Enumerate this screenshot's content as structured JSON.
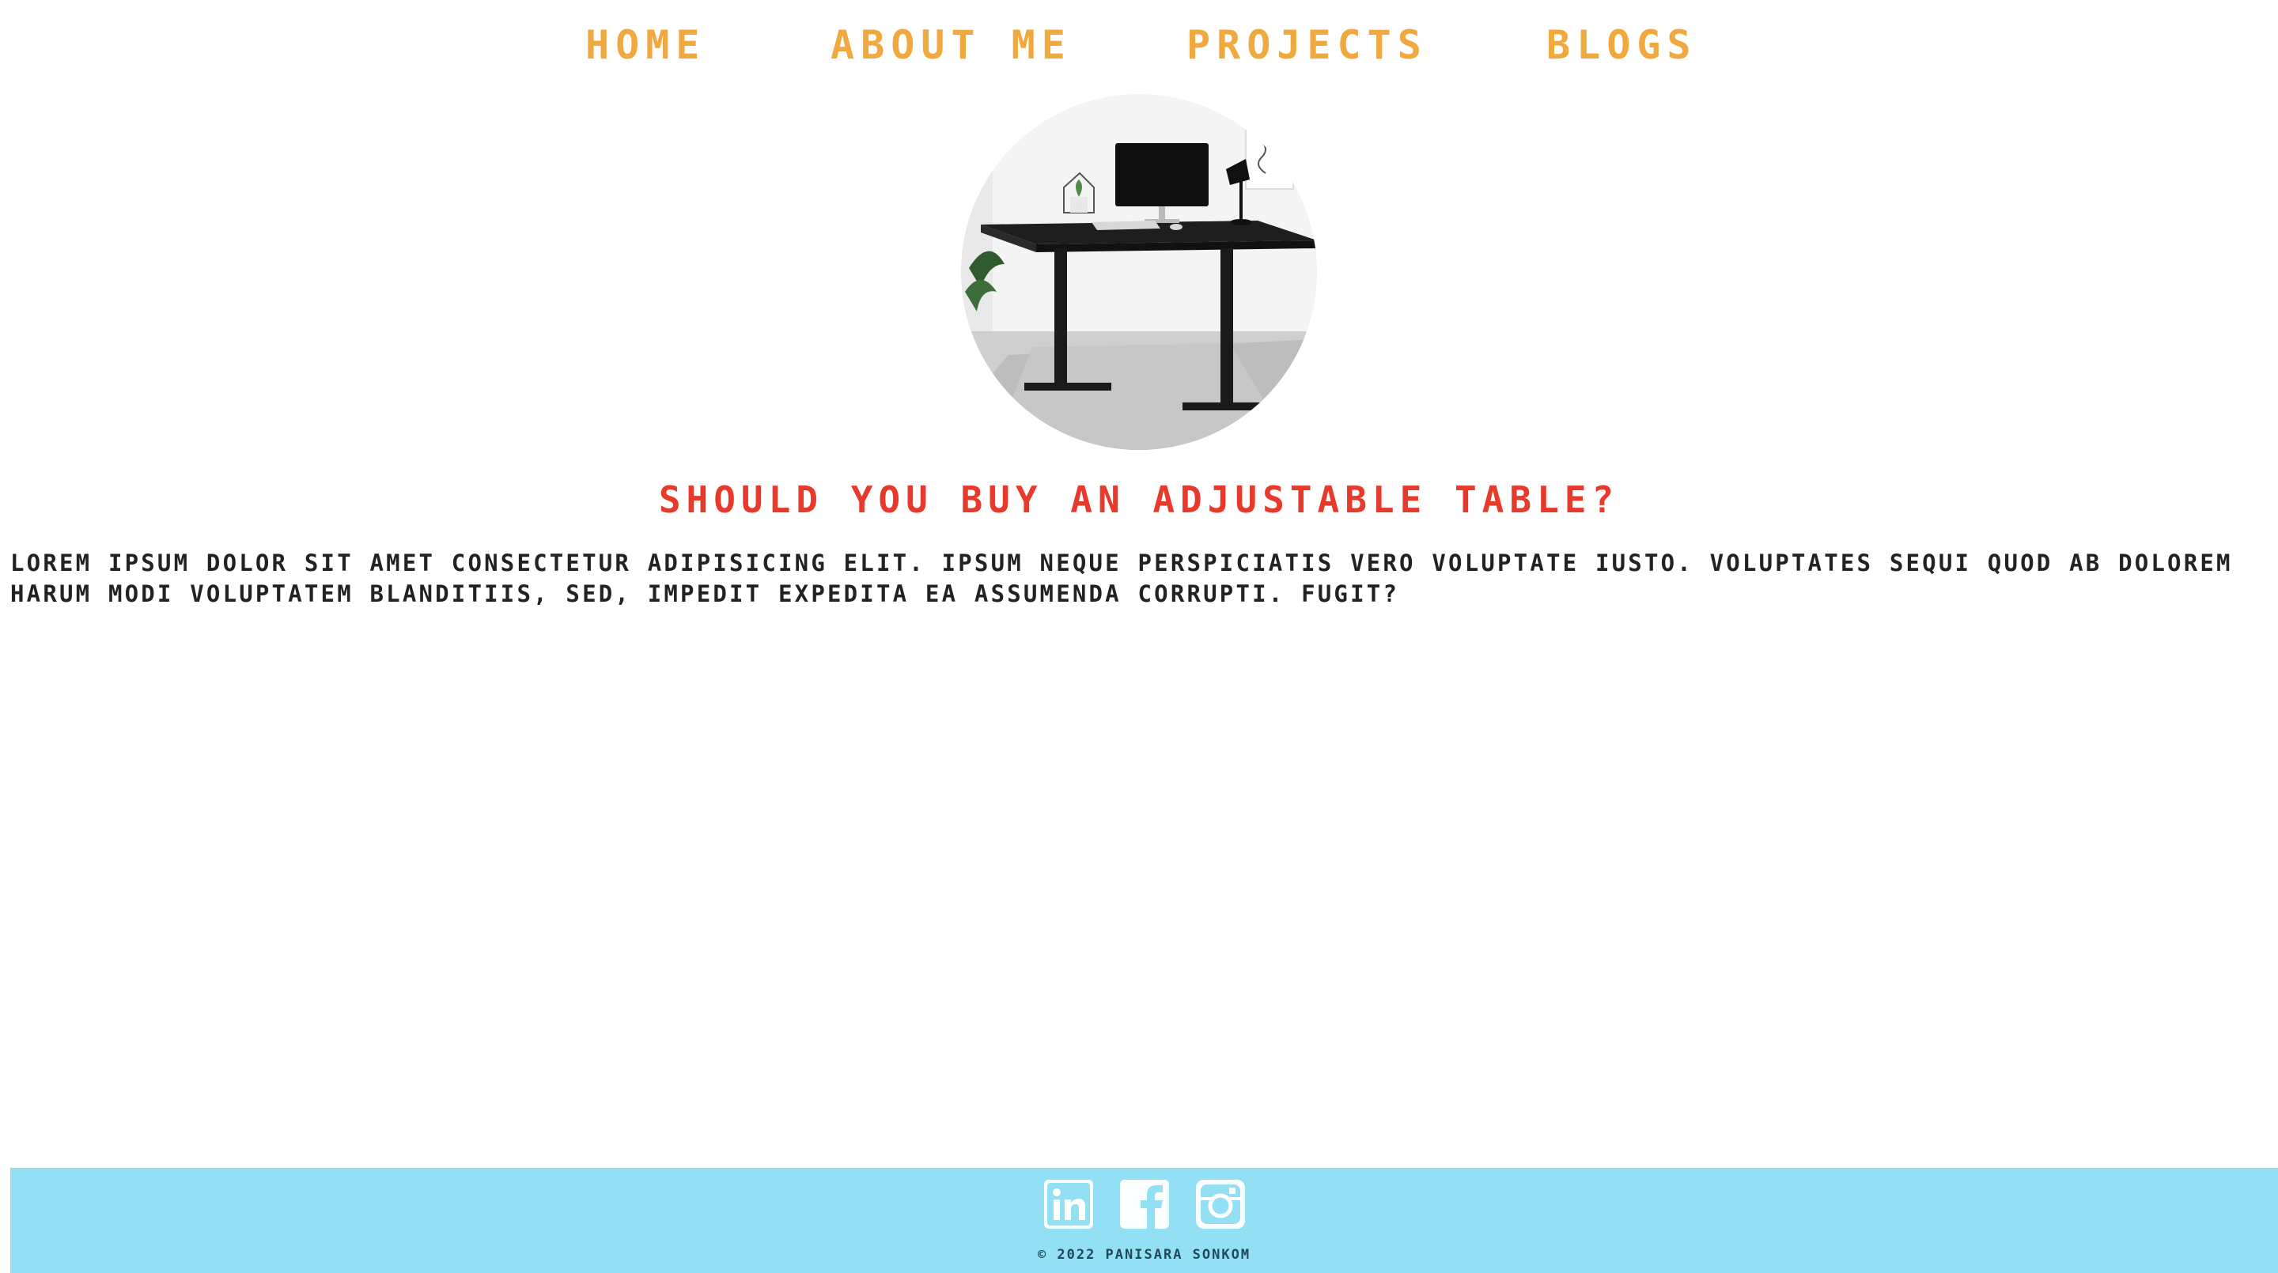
{
  "nav": {
    "items": [
      {
        "label": "Home"
      },
      {
        "label": "About me"
      },
      {
        "label": "Projects"
      },
      {
        "label": "Blogs"
      }
    ]
  },
  "hero": {
    "icon": "desk-photo"
  },
  "article": {
    "title": "Should you buy an adjustable table?",
    "body": "Lorem ipsum dolor sit amet consectetur adipisicing elit. Ipsum neque perspiciatis vero voluptate iusto. Voluptates sequi quod ab dolorem harum modi voluptatem blanditiis, sed, impedit expedita ea assumenda corrupti. Fugit?"
  },
  "footer": {
    "socials": [
      {
        "icon": "linkedin-icon"
      },
      {
        "icon": "facebook-icon"
      },
      {
        "icon": "instagram-icon"
      }
    ],
    "copyright": "© 2022 Panisara Sonkom"
  },
  "colors": {
    "nav": "#f0a93e",
    "title": "#e83a2c",
    "footer_bg": "#93dff3",
    "icon": "#ffffff"
  }
}
